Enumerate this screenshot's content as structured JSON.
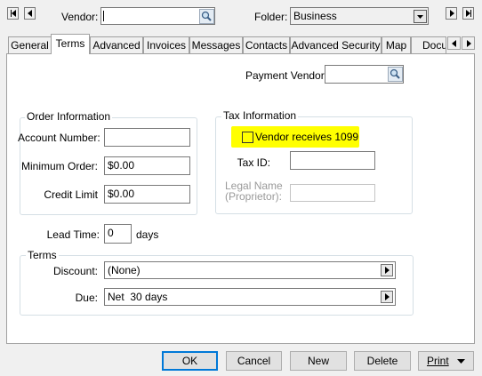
{
  "toolbar": {
    "vendor_label": "Vendor:",
    "vendor_value": "",
    "folder_label": "Folder:",
    "folder_value": "Business"
  },
  "tabs": [
    {
      "label": "General"
    },
    {
      "label": "Terms",
      "active": true
    },
    {
      "label": "Advanced"
    },
    {
      "label": "Invoices"
    },
    {
      "label": "Messages"
    },
    {
      "label": "Contacts"
    },
    {
      "label": "Advanced Security"
    },
    {
      "label": "Map"
    },
    {
      "label": "Docu"
    }
  ],
  "terms_page": {
    "payment_vendor_label": "Payment Vendor:",
    "payment_vendor_value": "",
    "order_info": {
      "title": "Order Information",
      "account_number_label": "Account Number:",
      "account_number_value": "",
      "minimum_order_label": "Minimum Order:",
      "minimum_order_value": "$0.00",
      "credit_limit_label": "Credit Limit",
      "credit_limit_value": "$0.00"
    },
    "tax_info": {
      "title": "Tax Information",
      "vendor_1099_label": "Vendor receives 1099",
      "vendor_1099_checked": false,
      "highlight_color": "#ffff00",
      "tax_id_label": "Tax ID:",
      "tax_id_value": "",
      "legal_name_label_line1": "Legal Name",
      "legal_name_label_line2": "(Proprietor):",
      "legal_name_value": ""
    },
    "lead_time_label": "Lead Time:",
    "lead_time_value": "0",
    "lead_time_unit": "days",
    "terms_group": {
      "title": "Terms",
      "discount_label": "Discount:",
      "discount_value": "(None)",
      "due_label": "Due:",
      "due_value": "Net  30 days"
    }
  },
  "buttons": {
    "ok": "OK",
    "cancel": "Cancel",
    "new": "New",
    "delete": "Delete",
    "print": "Print"
  }
}
